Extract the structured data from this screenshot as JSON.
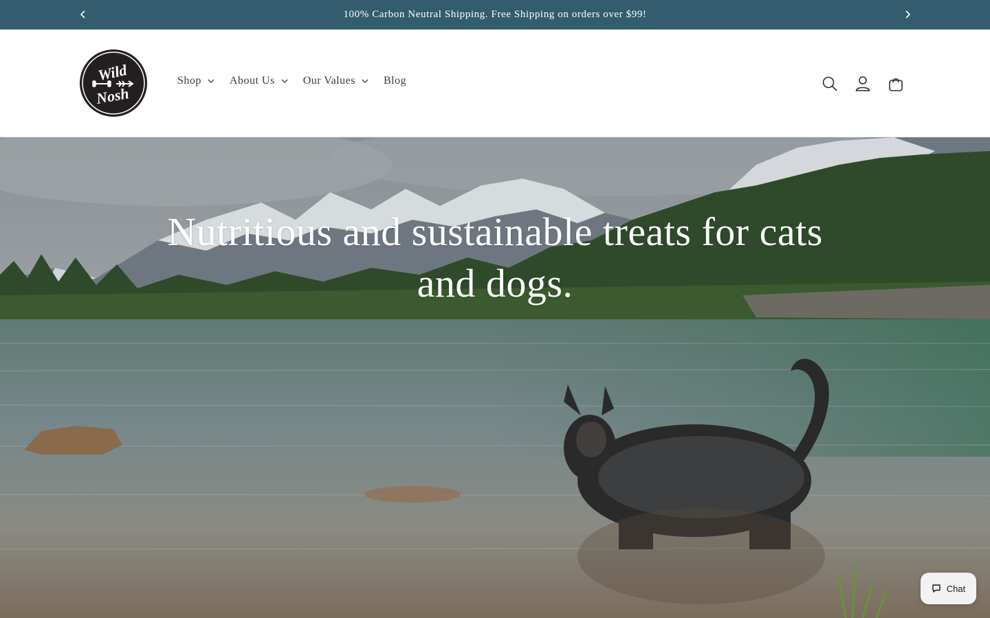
{
  "announcement": {
    "text": "100% Carbon Neutral Shipping. Free Shipping on orders over $99!",
    "prev_icon": "chevron-left-icon",
    "next_icon": "chevron-right-icon"
  },
  "header": {
    "logo": {
      "line1": "Wild",
      "line2": "Nosh"
    },
    "nav": [
      {
        "label": "Shop",
        "has_dropdown": true
      },
      {
        "label": "About Us",
        "has_dropdown": true
      },
      {
        "label": "Our Values",
        "has_dropdown": true
      },
      {
        "label": "Blog",
        "has_dropdown": false
      }
    ],
    "icons": [
      "search-icon",
      "account-icon",
      "cart-icon"
    ]
  },
  "hero": {
    "heading": "Nutritious and sustainable treats for cats and dogs."
  },
  "chat": {
    "label": "Chat",
    "icon": "chat-bubble-icon"
  },
  "colors": {
    "announcement_bg": "#335c6e",
    "header_bg": "#ffffff",
    "nav_text": "#3a3a3a",
    "hero_text": "#ffffff"
  }
}
